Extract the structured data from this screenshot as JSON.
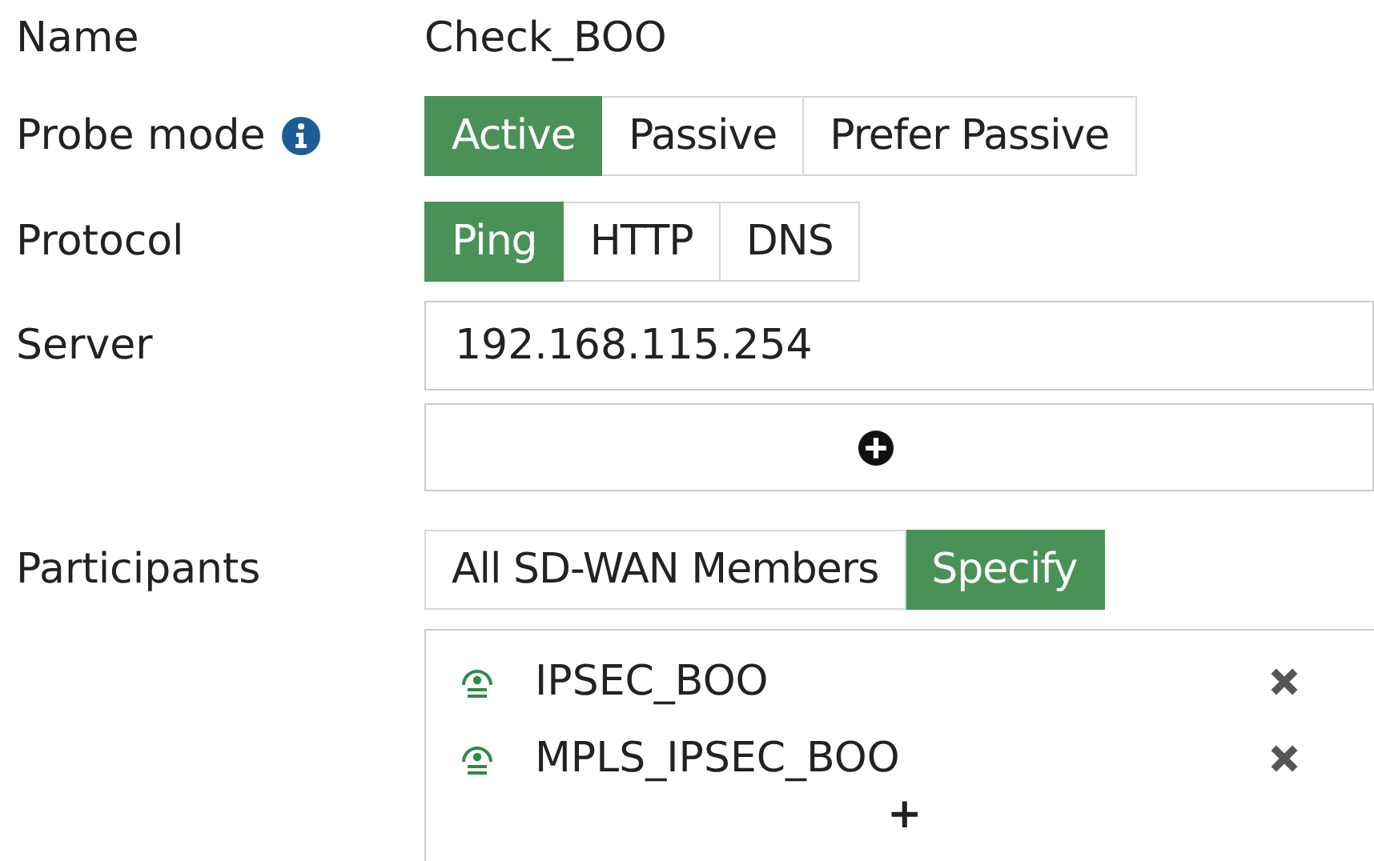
{
  "name": {
    "label": "Name",
    "value": "Check_BOO"
  },
  "probe_mode": {
    "label": "Probe mode",
    "options": [
      {
        "label": "Active",
        "selected": true
      },
      {
        "label": "Passive",
        "selected": false
      },
      {
        "label": "Prefer Passive",
        "selected": false
      }
    ]
  },
  "protocol": {
    "label": "Protocol",
    "options": [
      {
        "label": "Ping",
        "selected": true
      },
      {
        "label": "HTTP",
        "selected": false
      },
      {
        "label": "DNS",
        "selected": false
      }
    ]
  },
  "server": {
    "label": "Server",
    "value": "192.168.115.254"
  },
  "participants": {
    "label": "Participants",
    "options": [
      {
        "label": "All SD-WAN Members",
        "selected": false
      },
      {
        "label": "Specify",
        "selected": true
      }
    ],
    "members": [
      {
        "name": "IPSEC_BOO"
      },
      {
        "name": "MPLS_IPSEC_BOO"
      }
    ],
    "add": "+"
  }
}
